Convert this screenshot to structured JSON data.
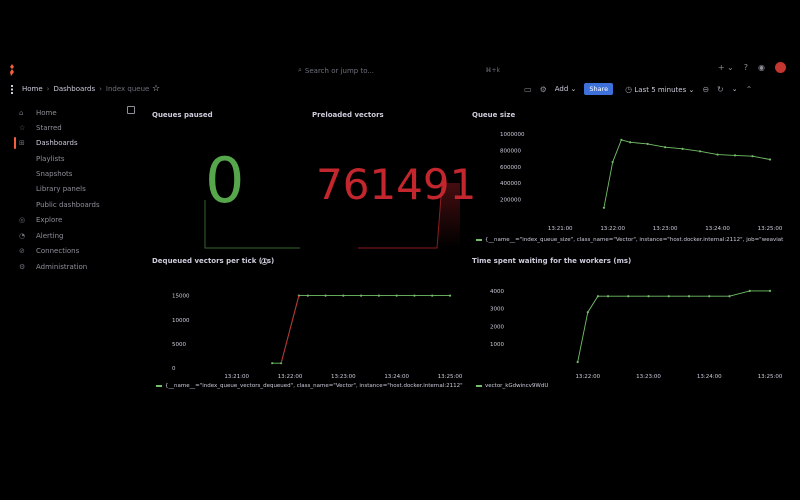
{
  "topbar": {
    "search_placeholder": "Search or jump to...",
    "search_shortcut": "⌘+k",
    "plus": "+ ⌄",
    "help": "?",
    "rss": "◉"
  },
  "breadcrumbs": {
    "home": "Home",
    "dashboards": "Dashboards",
    "current": "Index queue",
    "sep": "›"
  },
  "toolbar": {
    "add_label": "Add",
    "share_label": "Share",
    "time_range": "Last 5 minutes",
    "caret": "⌄"
  },
  "sidebar": {
    "items": [
      {
        "label": "Home",
        "icon": "home-icon",
        "glyph": "⌂"
      },
      {
        "label": "Starred",
        "icon": "star-icon",
        "glyph": "☆"
      },
      {
        "label": "Dashboards",
        "icon": "dashboards-icon",
        "glyph": "⊞"
      },
      {
        "label": "Playlists",
        "icon": "",
        "glyph": ""
      },
      {
        "label": "Snapshots",
        "icon": "",
        "glyph": ""
      },
      {
        "label": "Library panels",
        "icon": "",
        "glyph": ""
      },
      {
        "label": "Public dashboards",
        "icon": "",
        "glyph": ""
      },
      {
        "label": "Explore",
        "icon": "compass-icon",
        "glyph": "◎"
      },
      {
        "label": "Alerting",
        "icon": "bell-icon",
        "glyph": "◔"
      },
      {
        "label": "Connections",
        "icon": "connections-icon",
        "glyph": "⊘"
      },
      {
        "label": "Administration",
        "icon": "gear-icon",
        "glyph": "⚙"
      }
    ]
  },
  "panels": {
    "queues_paused": {
      "title": "Queues paused",
      "value": "0",
      "color": "#56a64b"
    },
    "preloaded_vectors": {
      "title": "Preloaded vectors",
      "value": "761491",
      "color": "#c4262e"
    },
    "queue_size": {
      "title": "Queue size",
      "legend": "{__name__=\"index_queue_size\", class_name=\"Vector\", instance=\"host.docker.internal:2112\", job=\"weaviat"
    },
    "dequeued": {
      "title": "Dequeued vectors per tick (1s)",
      "legend": "{__name__=\"index_queue_vectors_dequeued\", class_name=\"Vector\", instance=\"host.docker.internal:2112\""
    },
    "waiting": {
      "title": "Time spent waiting for the workers (ms)",
      "legend": "vector_kGdwincv9WdU"
    }
  },
  "chart_data": [
    {
      "type": "line",
      "title": "Queue size",
      "x": [
        "13:21:50",
        "13:22:00",
        "13:22:10",
        "13:22:20",
        "13:22:40",
        "13:23:00",
        "13:23:20",
        "13:23:40",
        "13:24:00",
        "13:24:20",
        "13:24:40",
        "13:25:00"
      ],
      "ticks_x": [
        "13:21:00",
        "13:22:00",
        "13:23:00",
        "13:24:00",
        "13:25:00"
      ],
      "ticks_y": [
        "200000",
        "400000",
        "600000",
        "800000",
        "1000000"
      ],
      "series": [
        {
          "values": [
            100000,
            660000,
            930000,
            900000,
            880000,
            840000,
            820000,
            790000,
            750000,
            740000,
            730000,
            690000
          ]
        }
      ],
      "ylim": [
        0,
        1050000
      ],
      "color": "#73bf69"
    },
    {
      "type": "line",
      "title": "Dequeued vectors per tick (1s)",
      "x": [
        "13:21:40",
        "13:21:50",
        "13:22:10",
        "13:22:20",
        "13:22:40",
        "13:23:00",
        "13:23:20",
        "13:23:40",
        "13:24:00",
        "13:24:20",
        "13:24:40",
        "13:25:00"
      ],
      "ticks_x": [
        "13:21:00",
        "13:22:00",
        "13:23:00",
        "13:24:00",
        "13:25:00"
      ],
      "ticks_y": [
        "0",
        "5000",
        "10000",
        "15000"
      ],
      "series": [
        {
          "values": [
            1000,
            1000,
            15000,
            15000,
            15000,
            15000,
            15000,
            15000,
            15000,
            15000,
            15000,
            15000
          ]
        }
      ],
      "ylim": [
        0,
        17000
      ],
      "color": "#73bf69"
    },
    {
      "type": "line",
      "title": "Time spent waiting for the workers (ms)",
      "x": [
        "13:21:50",
        "13:22:00",
        "13:22:10",
        "13:22:20",
        "13:22:40",
        "13:23:00",
        "13:23:20",
        "13:23:40",
        "13:24:00",
        "13:24:20",
        "13:24:40",
        "13:25:00"
      ],
      "ticks_x": [
        "13:22:00",
        "13:23:00",
        "13:24:00",
        "13:25:00"
      ],
      "ticks_y": [
        "1000",
        "2000",
        "3000",
        "4000"
      ],
      "series": [
        {
          "values": [
            0,
            2800,
            3700,
            3700,
            3700,
            3700,
            3700,
            3700,
            3700,
            3700,
            4000,
            4000
          ]
        }
      ],
      "ylim": [
        0,
        4500
      ],
      "color": "#73bf69"
    }
  ]
}
